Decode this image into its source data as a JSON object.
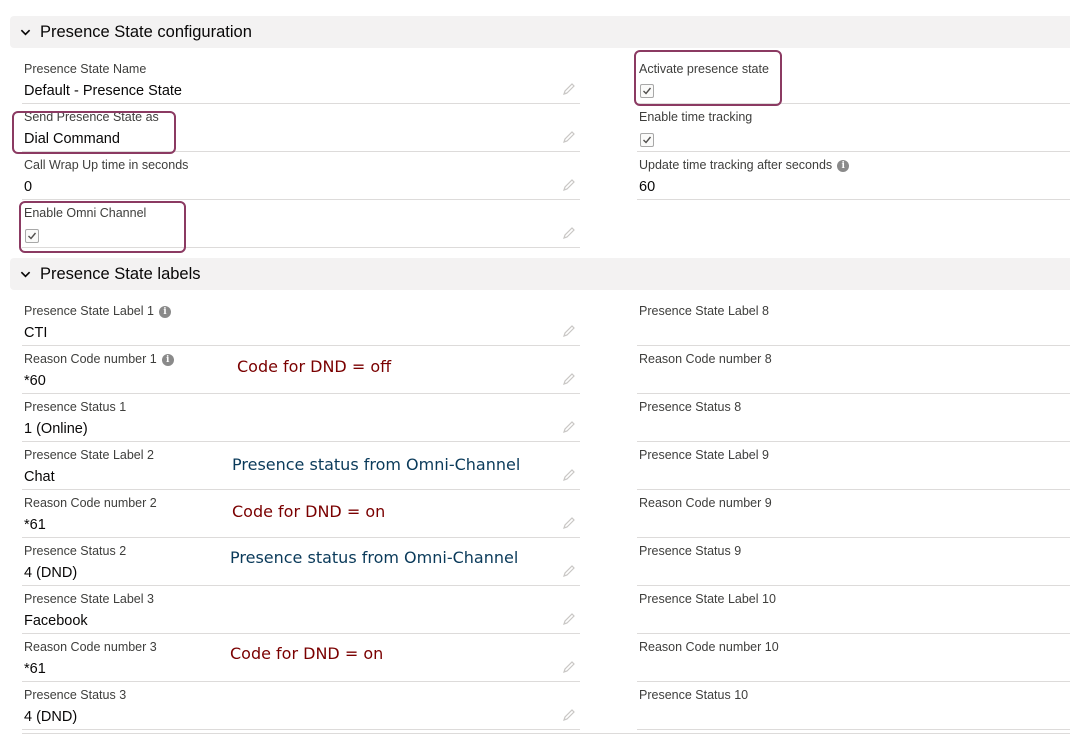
{
  "config_section": {
    "title": "Presence State configuration",
    "left": [
      {
        "label": "Presence State Name",
        "value": "Default - Presence State"
      },
      {
        "label": "Send Presence State as",
        "value": "Dial Command"
      },
      {
        "label": "Call Wrap Up time in seconds",
        "value": "0"
      },
      {
        "label": "Enable Omni Channel",
        "checked": true
      }
    ],
    "right": [
      {
        "label": "Activate presence state",
        "checked": true
      },
      {
        "label": "Enable time tracking",
        "checked": true
      },
      {
        "label": "Update time tracking after seconds",
        "value": "60"
      }
    ]
  },
  "labels_section": {
    "title": "Presence State labels",
    "left": [
      {
        "label": "Presence State Label 1",
        "value": "CTI"
      },
      {
        "label": "Reason Code number 1",
        "value": "*60"
      },
      {
        "label": "Presence Status 1",
        "value": "1 (Online)"
      },
      {
        "label": "Presence State Label 2",
        "value": "Chat"
      },
      {
        "label": "Reason Code number 2",
        "value": "*61"
      },
      {
        "label": "Presence Status 2",
        "value": "4 (DND)"
      },
      {
        "label": "Presence State Label 3",
        "value": "Facebook"
      },
      {
        "label": "Reason Code number 3",
        "value": "*61"
      },
      {
        "label": "Presence Status 3",
        "value": "4 (DND)"
      }
    ],
    "right": [
      {
        "label": "Presence State Label 8",
        "value": ""
      },
      {
        "label": "Reason Code number 8",
        "value": ""
      },
      {
        "label": "Presence Status 8",
        "value": ""
      },
      {
        "label": "Presence State Label 9",
        "value": ""
      },
      {
        "label": "Reason Code number 9",
        "value": ""
      },
      {
        "label": "Presence Status 9",
        "value": ""
      },
      {
        "label": "Presence State Label 10",
        "value": ""
      },
      {
        "label": "Reason Code number 10",
        "value": ""
      },
      {
        "label": "Presence Status 10",
        "value": ""
      }
    ]
  },
  "annotations": [
    "Code for DND = off",
    "Presence status from Omni-Channel",
    "Code for DND = on",
    "Presence status from Omni-Channel",
    "Code for DND = on"
  ],
  "icons": {
    "section_toggle": "chevron-down-icon",
    "edit": "pencil-icon",
    "info": "info-icon",
    "checkbox": "checkmark-icon"
  },
  "colors": {
    "header_bg": "#f3f2f2",
    "highlight_border": "#8b3a62",
    "note_red": "#7a0000",
    "note_blue": "#0a3a5a"
  }
}
